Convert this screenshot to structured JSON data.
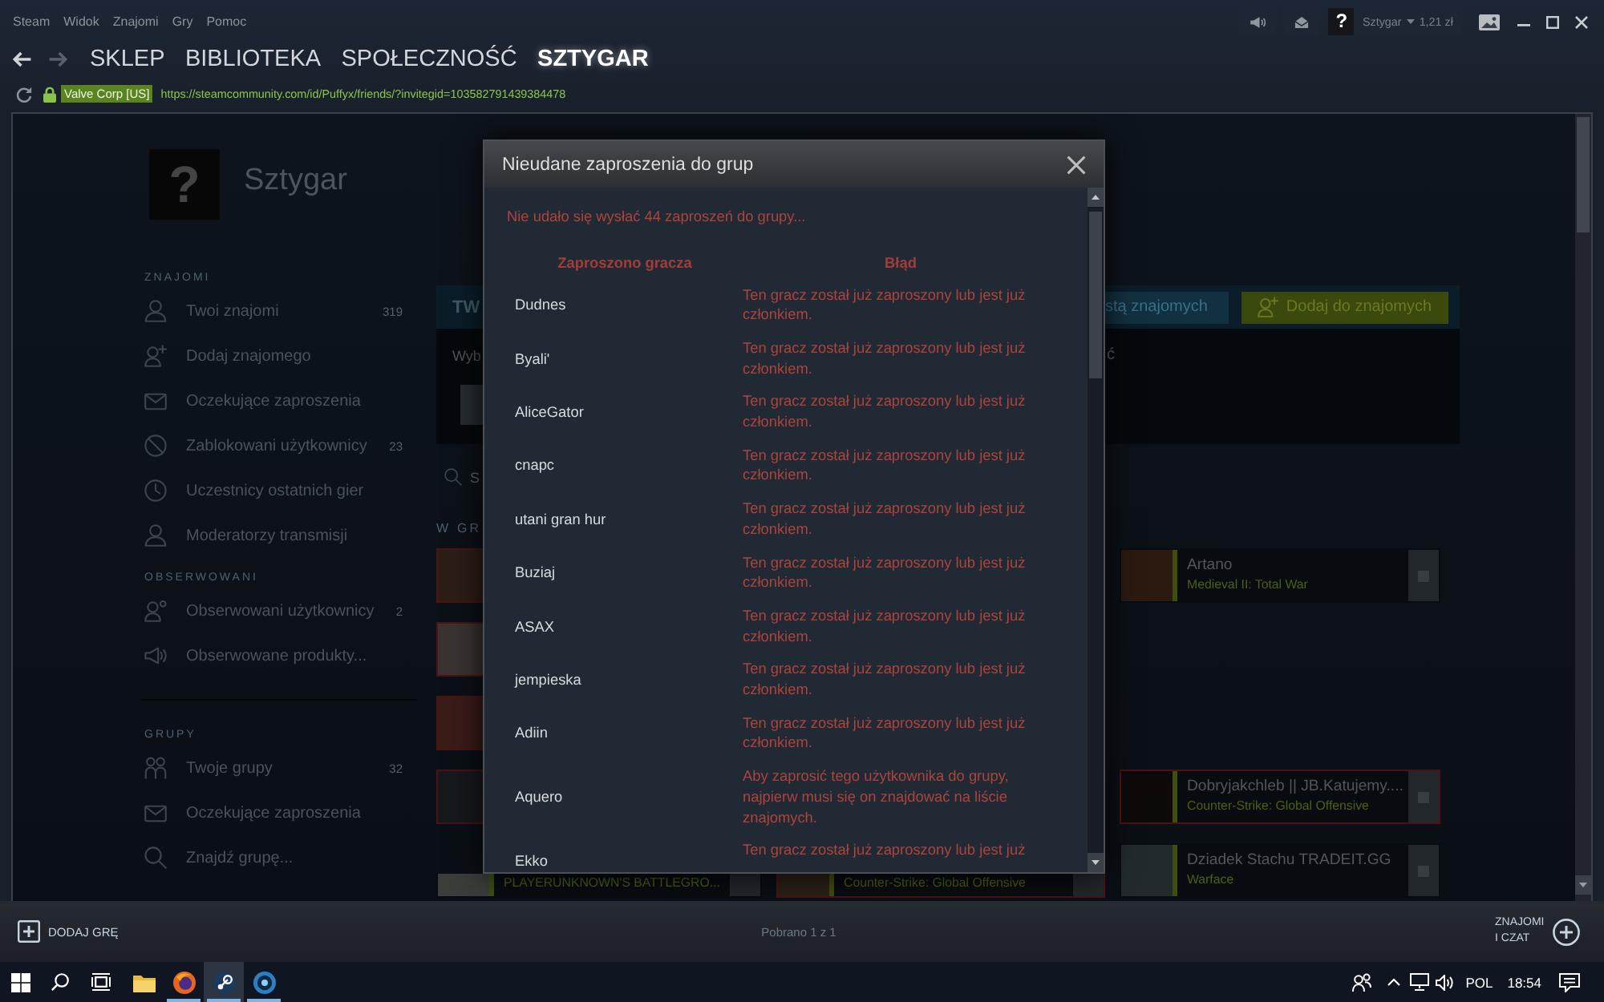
{
  "menu_bar": {
    "items": [
      "Steam",
      "Widok",
      "Znajomi",
      "Gry",
      "Pomoc"
    ],
    "help": "?",
    "account": {
      "name": "Sztygar",
      "balance": "1,21 zł"
    }
  },
  "nav": {
    "tabs": [
      {
        "label": "SKLEP",
        "selected": false
      },
      {
        "label": "BIBLIOTEKA",
        "selected": false
      },
      {
        "label": "SPOŁECZNOŚĆ",
        "selected": false
      },
      {
        "label": "SZTYGAR",
        "selected": true
      }
    ]
  },
  "address_bar": {
    "certificate": "Valve Corp [US]",
    "url": "https://steamcommunity.com/id/Puffyx/friends/?invitegid=103582791439384478"
  },
  "profile": {
    "avatar": "?",
    "name": "Sztygar"
  },
  "sidebar": {
    "sections": [
      {
        "title": "ZNAJOMI",
        "items": [
          {
            "label": "Twoi znajomi",
            "count": "319"
          },
          {
            "label": "Dodaj znajomego"
          },
          {
            "label": "Oczekujące zaproszenia"
          },
          {
            "label": "Zablokowani użytkownicy",
            "count": "23"
          },
          {
            "label": "Uczestnicy ostatnich gier"
          },
          {
            "label": "Moderatorzy transmisji"
          }
        ]
      },
      {
        "title": "OBSERWOWANI",
        "items": [
          {
            "label": "Obserwowani użytkownicy",
            "count": "2"
          },
          {
            "label": "Obserwowane produkty..."
          }
        ]
      },
      {
        "title": "GRUPY",
        "items": [
          {
            "label": "Twoje grupy",
            "count": "32"
          },
          {
            "label": "Oczekujące zaproszenia"
          },
          {
            "label": "Znajdź grupę..."
          }
        ]
      }
    ]
  },
  "friends": {
    "header": "TW",
    "header_buttons": [
      {
        "label": "stą znajomych",
        "kind": "secondary"
      },
      {
        "label": "Dodaj do znajomych",
        "kind": "primary"
      }
    ],
    "panel": {
      "text": "Wyb",
      "text_right": "ć"
    },
    "search": {
      "placeholder": "S"
    },
    "in_game": {
      "label": "W GR",
      "rows": [
        {
          "left": {
            "kind": "avatar",
            "flagged": true
          },
          "right": {
            "kind": "card",
            "name": "Artano",
            "game": "Medieval II: Total War",
            "flagged": false
          }
        },
        {
          "left": {
            "kind": "avatar",
            "flagged": true
          }
        },
        {
          "left": {
            "kind": "avatar",
            "flagged": true
          }
        },
        {
          "left": {
            "kind": "avatar",
            "flagged": true
          },
          "right": {
            "kind": "card",
            "name": "Dobryjakchleb || JB.Katujemy....",
            "game": "Counter-Strike: Global Offensive",
            "flagged": true
          }
        },
        {
          "left": {
            "kind": "card_bottom",
            "game": "PLAYERUNKNOWN'S BATTLEGRO...",
            "flagged": false
          },
          "middle": {
            "kind": "card_bottom",
            "game": "Counter-Strike: Global Offensive",
            "flagged": true
          },
          "right": {
            "kind": "card",
            "name": "Dziadek Stachu TRADEIT.GG",
            "game": "Warface",
            "flagged": false
          }
        }
      ]
    }
  },
  "dialog": {
    "title": "Nieudane zaproszenia do grup",
    "message": "Nie udało się wysłać 44 zaproszeń do grupy...",
    "columns": [
      "Zaproszono gracza",
      "Błąd"
    ],
    "rows": [
      {
        "player": "Dudnes",
        "error": "Ten gracz został już zaproszony lub jest już członkiem."
      },
      {
        "player": "Byali'",
        "error": "Ten gracz został już zaproszony lub jest już członkiem."
      },
      {
        "player": "AliceGator",
        "error": "Ten gracz został już zaproszony lub jest już członkiem."
      },
      {
        "player": "cnapc",
        "error": "Ten gracz został już zaproszony lub jest już członkiem."
      },
      {
        "player": "utani gran hur",
        "error": "Ten gracz został już zaproszony lub jest już członkiem."
      },
      {
        "player": "Buziaj",
        "error": "Ten gracz został już zaproszony lub jest już członkiem."
      },
      {
        "player": "ASAX",
        "error": "Ten gracz został już zaproszony lub jest już członkiem."
      },
      {
        "player": "jempieska",
        "error": "Ten gracz został już zaproszony lub jest już członkiem."
      },
      {
        "player": "Adiin",
        "error": "Ten gracz został już zaproszony lub jest już członkiem."
      },
      {
        "player": "Aquero",
        "error": "Aby zaprosić tego użytkownika do grupy, najpierw musi się on znajdować na liście znajomych."
      },
      {
        "player": "Ekko",
        "error": "Ten gracz został już zaproszony lub jest już"
      }
    ]
  },
  "bottom_bar": {
    "add_game": "DODAJ GRĘ",
    "status": "Pobrano 1 z 1",
    "friends_chat": "ZNAJOMI I CZAT"
  },
  "taskbar": {
    "apps": [
      {
        "running": false,
        "selected": false
      },
      {
        "running": true,
        "selected": false
      },
      {
        "running": true,
        "selected": true
      },
      {
        "running": true,
        "selected": false
      }
    ],
    "language": "POL",
    "time": "18:54"
  }
}
